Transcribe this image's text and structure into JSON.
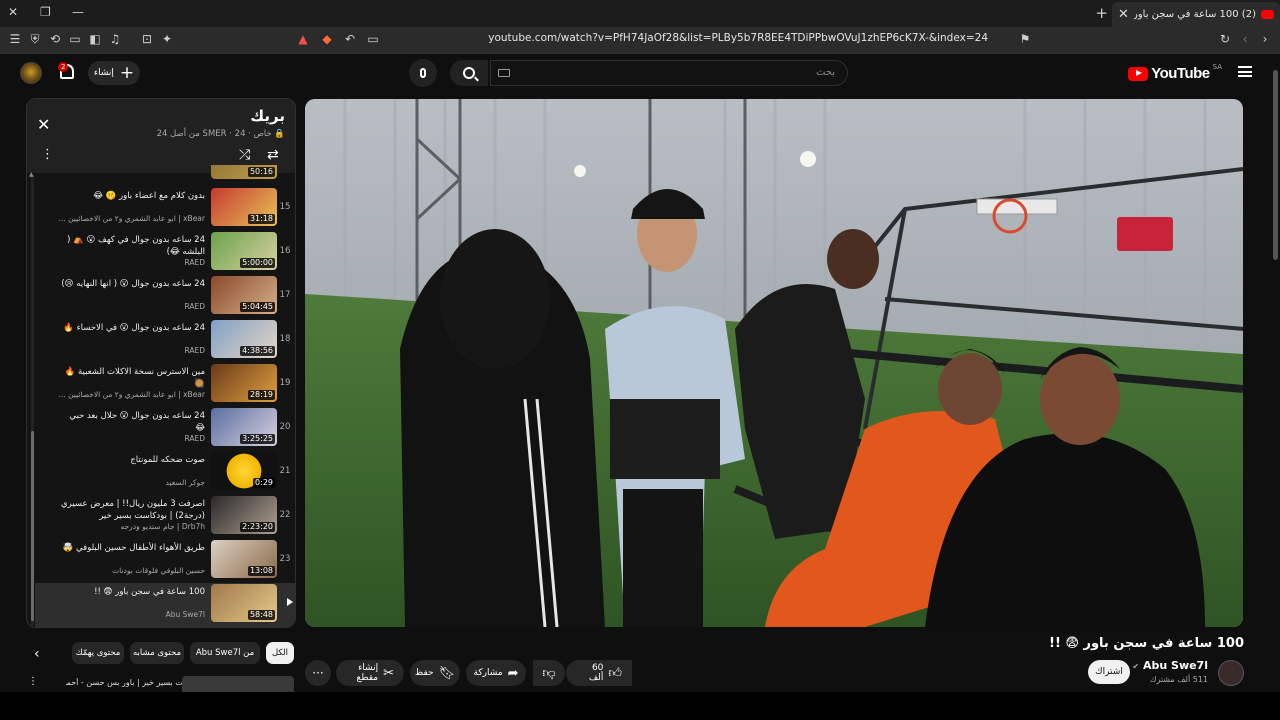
{
  "browser": {
    "tab_title": "(2) 100 ساعة في سجن باور 😨",
    "tab_close": "✕",
    "new_tab": "+",
    "url": "youtube.com/watch?v=PfH74JaOf28&list=PLBy5b7R8EE4TDiPPbwOVuJ1zhEP6cK7X-&index=24"
  },
  "header": {
    "logo_text": "YouTube",
    "country_code": "SA",
    "search_placeholder": "بحث",
    "create_label": "إنشاء",
    "notification_count": "2"
  },
  "playlist": {
    "title": "بريك",
    "subtitle": "🔒 خاص · SMER · 24 من أصل 24",
    "items": [
      {
        "num": "15",
        "title": "بدون كلام مع اعضاء باور 🤫 😂",
        "channel": "xBear | ابو عابد الشمري و٢ من الاخصائيين ...",
        "duration": "31:18"
      },
      {
        "num": "16",
        "title": "24 ساعه بدون جوال في كهف 😮 ⛺ ( البلشه 😂)",
        "channel": "RAED",
        "duration": "5:00:00"
      },
      {
        "num": "17",
        "title": "24 ساعه بدون جوال 😮 ( انها النهايه 😢)",
        "channel": "RAED",
        "duration": "5:04:45"
      },
      {
        "num": "18",
        "title": "24 ساعه بدون جوال 😮 في الاحساء 🔥",
        "channel": "RAED",
        "duration": "4:38:56"
      },
      {
        "num": "19",
        "title": "مين الاسترس نسخة الاكلات الشعبية 🔥 🥘",
        "channel": "xBear | ابو عابد الشمري و٢ من الاخصائيين ...",
        "duration": "28:19"
      },
      {
        "num": "20",
        "title": "24 ساعه بدون جوال 😮 حلال بعد حبي 😂",
        "channel": "RAED",
        "duration": "3:25:25"
      },
      {
        "num": "21",
        "title": "صوت ضحكه للمونتاج",
        "channel": "جوكر السعيد",
        "duration": "0:29"
      },
      {
        "num": "22",
        "title": "اصرفت 3 مليون ريال!! | معرض عسيري (درجة2) | بودكاست بسير خير",
        "channel": "Drb7h | جام ستديو ودرجه",
        "duration": "2:23:20"
      },
      {
        "num": "23",
        "title": "طريق الأهواء الأطفال حسين البلوفي 🤯",
        "channel": "حسين البلوفي فلوقات بودنات",
        "duration": "13:08"
      },
      {
        "num": "",
        "title": "100 ساعة في سجن باور 😨 !!",
        "channel": "Abu Swe7l",
        "duration": "58:48"
      }
    ]
  },
  "video": {
    "title": "100 ساعة في سجن باور 😨 !!",
    "channel_name": "Abu Swe7l",
    "verified": "✔",
    "subscribers": "511 ألف مشترك",
    "subscribe_label": "اشتراك",
    "likes": "60 ألف",
    "share_label": "مشاركة",
    "save_label": "حفظ",
    "clip_label": "إنشاء مقطع",
    "more_label": "···"
  },
  "chips": {
    "all": "الكل",
    "from_channel": "من Abu Swe7l",
    "related": "محتوى مشابه",
    "for_you": "محتوى يهمّك"
  },
  "recommendation": {
    "title": "بودكاست بسير خير | باور بس حسن - أحمد"
  },
  "colors": {
    "background": "#0f0f0f",
    "accent": "#ff0000",
    "chip_selected": "#f1f1f1"
  }
}
